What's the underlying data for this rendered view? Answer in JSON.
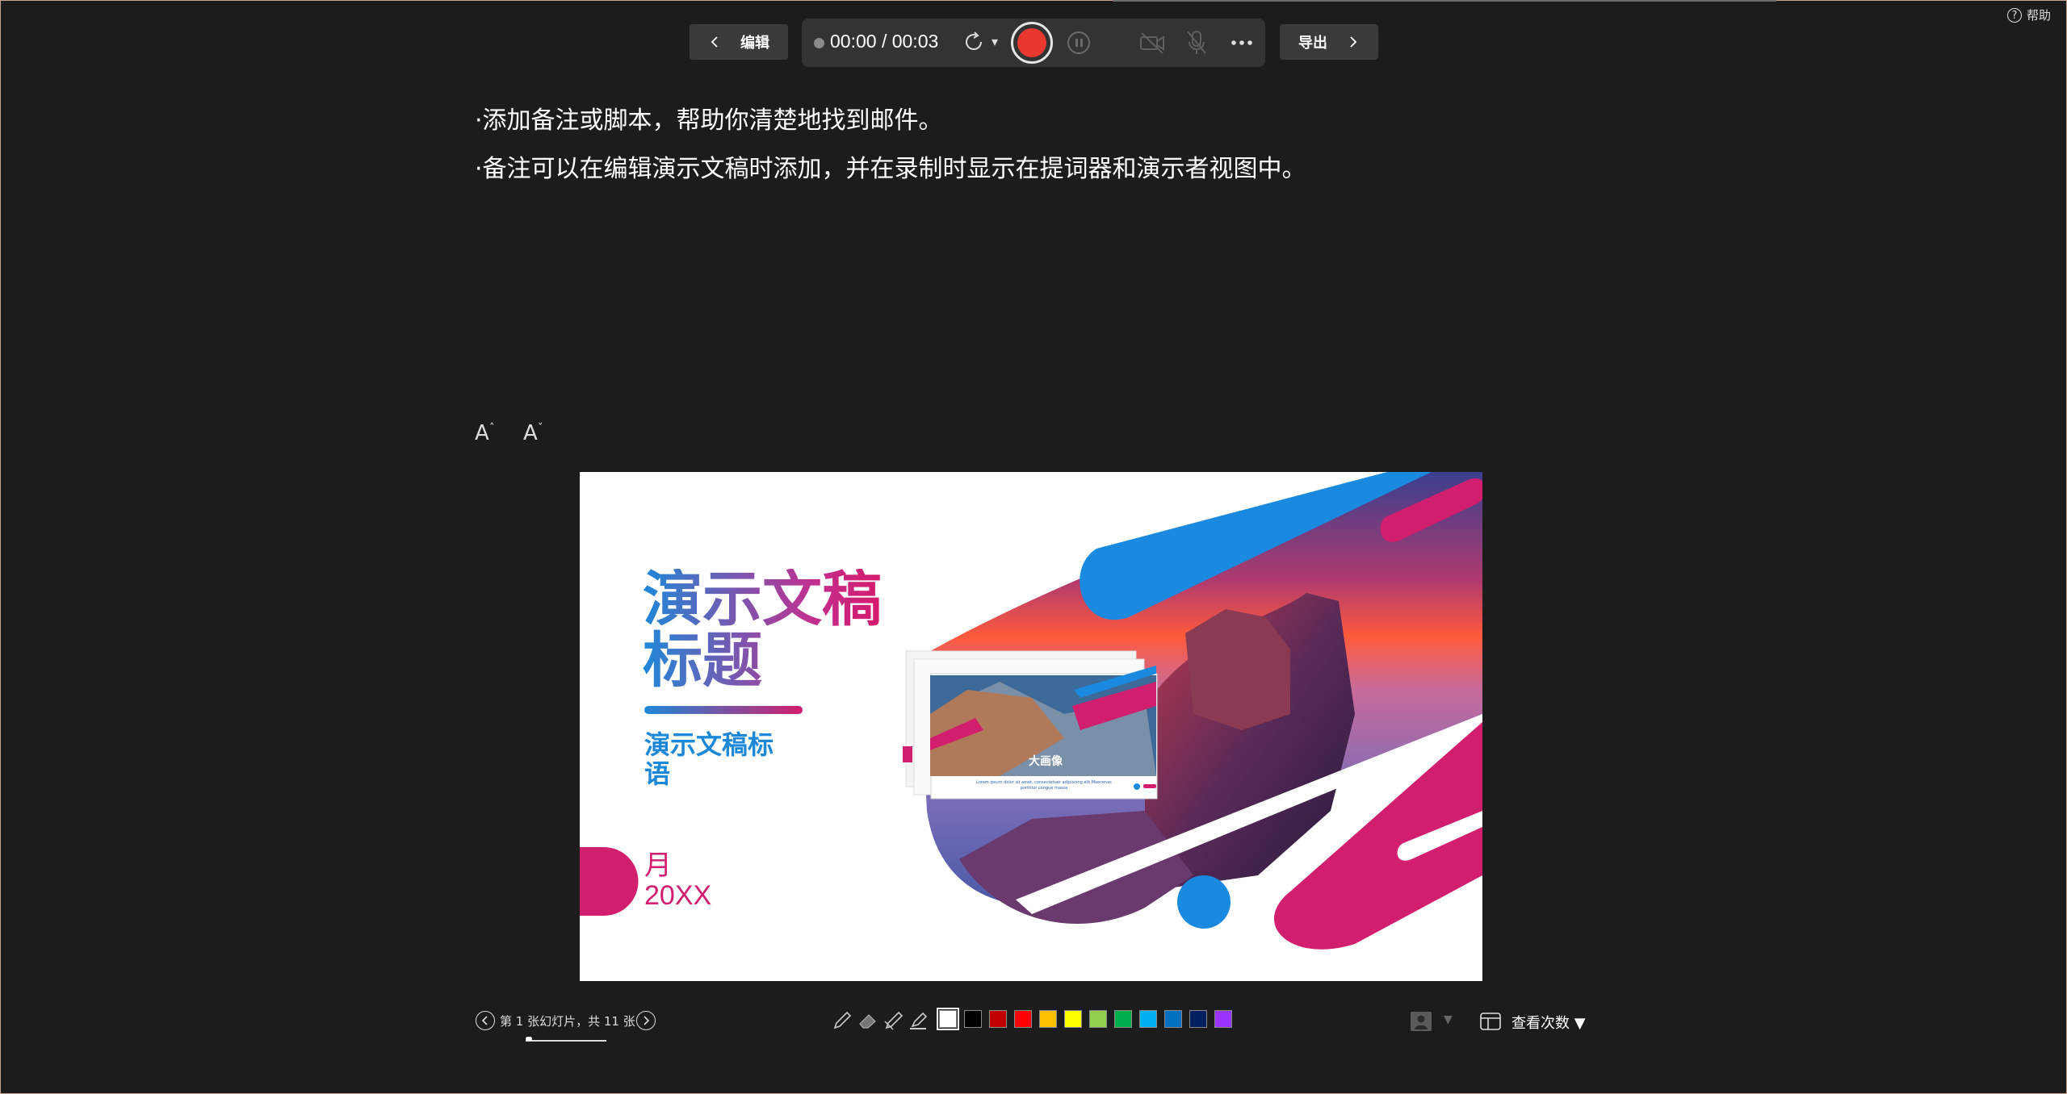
{
  "toolbar": {
    "edit_label": "编辑",
    "export_label": "导出",
    "timer": "00:00 / 00:03",
    "retake_caret": "▾",
    "accent_record_color": "#e8382f"
  },
  "help": {
    "label": "帮助",
    "icon_glyph": "?"
  },
  "notes": {
    "line1": "·添加备注或脚本，帮助你清楚地找到邮件。",
    "line2": "·备注可以在编辑演示文稿时添加，并在录制时显示在提词器和演示者视图中。"
  },
  "font_controls": {
    "increase": "A",
    "decrease": "A",
    "increase_mark": "ˆ",
    "decrease_mark": "ˇ"
  },
  "slide": {
    "title": "演示文稿标题",
    "subtitle": "演示文稿标语",
    "month": "月",
    "year": "20XX",
    "inner_caption": "大画像",
    "inner_text": "Lorem ipsum dolor sit amet, consectetuer adipiscing elit Maecenas porttitor congue massa"
  },
  "navigation": {
    "slide_counter": "第 1 张幻灯片，共 11 张",
    "current_slide": 1,
    "total_slides": 11
  },
  "pen_colors": [
    "#ffffff",
    "#000000",
    "#c00000",
    "#ff0000",
    "#ffc000",
    "#ffff00",
    "#92d050",
    "#00b050",
    "#00b0f0",
    "#0070c0",
    "#002060",
    "#9933ff"
  ],
  "bottom_right": {
    "presenter_caret": "▼",
    "views_label": "查看次数 ▼"
  }
}
